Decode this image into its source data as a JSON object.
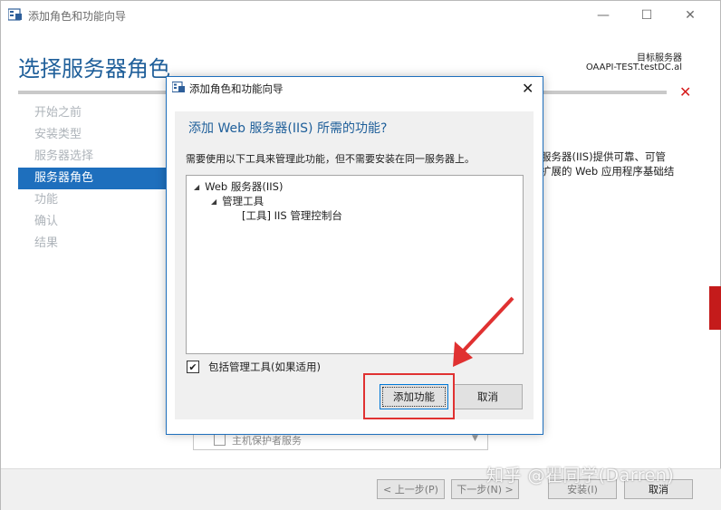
{
  "window": {
    "title": "添加角色和功能向导",
    "controls": {
      "minimize": "—",
      "maximize": "☐",
      "close": "✕"
    }
  },
  "header": {
    "page_title": "选择服务器角色",
    "destination_label": "目标服务器",
    "destination_server": "OAAPI-TEST.testDC.al",
    "error_indicator": "✕"
  },
  "nav": {
    "items": [
      {
        "label": "开始之前",
        "active": false
      },
      {
        "label": "安装类型",
        "active": false
      },
      {
        "label": "服务器选择",
        "active": false
      },
      {
        "label": "服务器角色",
        "active": true
      },
      {
        "label": "功能",
        "active": false
      },
      {
        "label": "确认",
        "active": false
      },
      {
        "label": "结果",
        "active": false
      }
    ]
  },
  "background": {
    "description_line1": "服务器(IIS)提供可靠、可管",
    "description_line2": "扩展的 Web 应用程序基础结",
    "partial_list_item": "主机保护者服务"
  },
  "footer": {
    "prev": "< 上一步(P)",
    "next": "下一步(N) >",
    "install": "安装(I)",
    "cancel": "取消"
  },
  "dialog": {
    "title": "添加角色和功能向导",
    "close": "✕",
    "heading": "添加 Web 服务器(IIS) 所需的功能?",
    "description": "需要使用以下工具来管理此功能，但不需要安装在同一服务器上。",
    "tree": [
      {
        "label": "Web 服务器(IIS)",
        "expander": "◢"
      },
      {
        "label": "管理工具",
        "expander": "◢"
      },
      {
        "label": "[工具] IIS 管理控制台",
        "expander": ""
      }
    ],
    "include_tools": {
      "checked": true,
      "mark": "✔",
      "label": "包括管理工具(如果适用)"
    },
    "add_button": "添加功能",
    "cancel_button": "取消"
  },
  "watermark": "知乎 @瞿同学(Darren)",
  "colors": {
    "accent_blue": "#1e6fbd",
    "title_blue": "#1f5f9a",
    "annotation_red": "#e03131",
    "error_red": "#d61d1d"
  }
}
